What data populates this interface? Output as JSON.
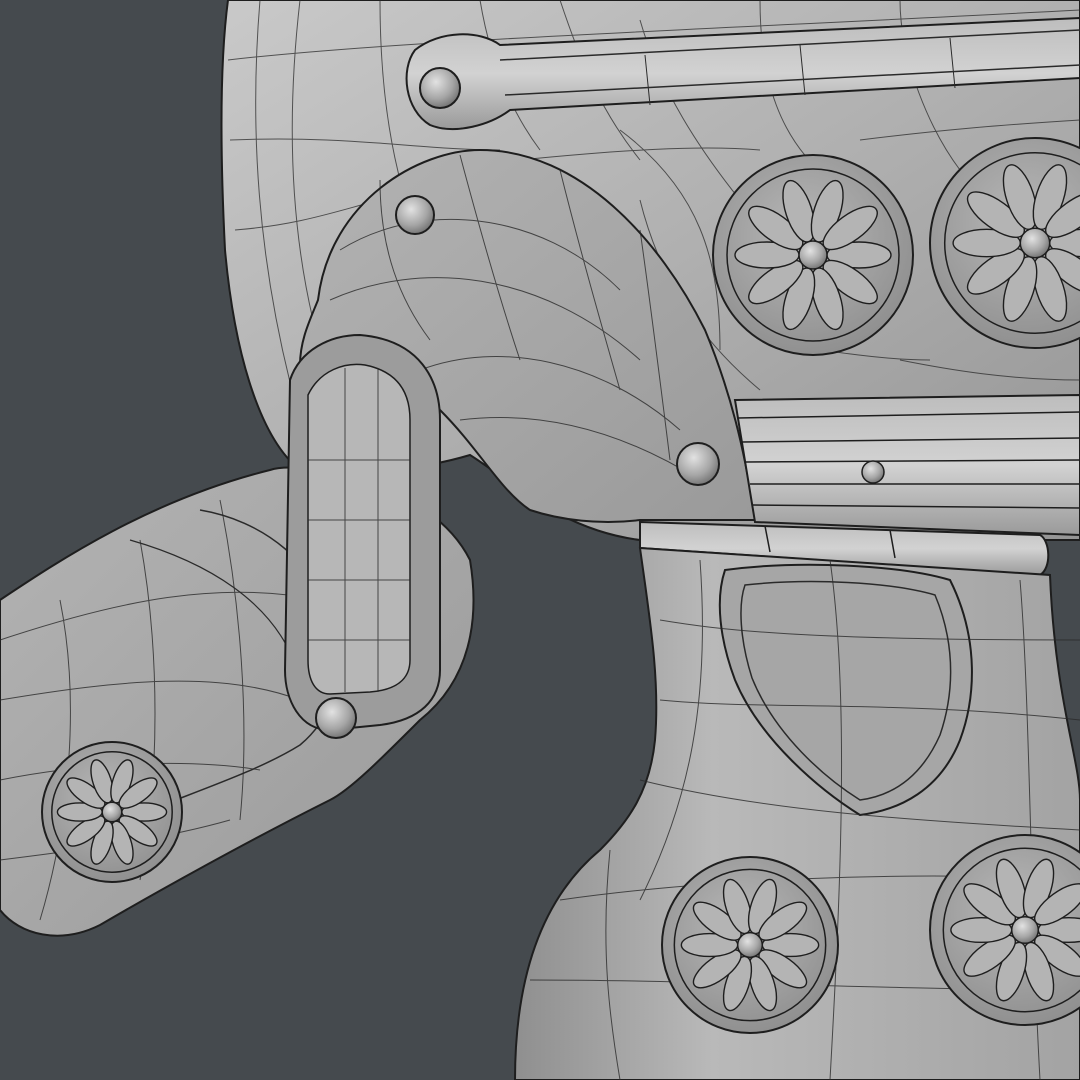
{
  "viewport": {
    "background": "#454a4e",
    "shading": "matcap-grey",
    "overlay": "wireframe"
  },
  "model": {
    "subject": "roman-helmet-3d-model",
    "mesh_color": "#a9a9a9",
    "wire_color": "#1e1e1e"
  },
  "rosettes": [
    {
      "id": "rosette-top-1",
      "petals": 10
    },
    {
      "id": "rosette-top-2",
      "petals": 10
    },
    {
      "id": "rosette-visor",
      "petals": 10
    },
    {
      "id": "rosette-cheek-1",
      "petals": 10
    },
    {
      "id": "rosette-cheek-2",
      "petals": 10
    }
  ]
}
